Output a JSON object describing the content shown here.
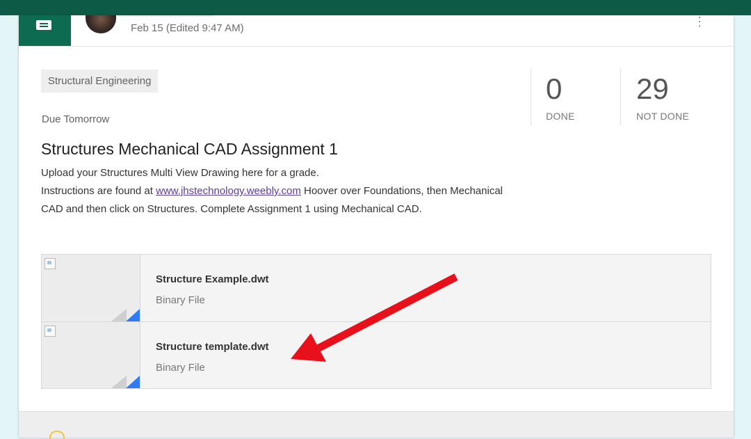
{
  "post": {
    "date": "Feb 15 (Edited 9:47 AM)",
    "more_icon": "more-vert-icon"
  },
  "topic": "Structural Engineering",
  "due": "Due Tomorrow",
  "stats": {
    "done_count": "0",
    "done_label": "DONE",
    "not_done_count": "29",
    "not_done_label": "NOT DONE"
  },
  "assignment": {
    "title": "Structures Mechanical CAD Assignment 1",
    "line1": "Upload your Structures Multi View Drawing here for a grade.",
    "instr_before": "Instructions are found at ",
    "link": "www.jhstechnology.weebly.com",
    "instr_after": " Hoover over Foundations, then Mechanical CAD and then click on Structures. Complete Assignment 1 using Mechanical CAD."
  },
  "attachments": [
    {
      "name": "Structure Example.dwt",
      "type": "Binary File"
    },
    {
      "name": "Structure template.dwt",
      "type": "Binary File"
    }
  ],
  "colors": {
    "header_green": "#0d5b46",
    "accent_blue": "#2d7bf6",
    "annotation_red": "#e8101a"
  }
}
